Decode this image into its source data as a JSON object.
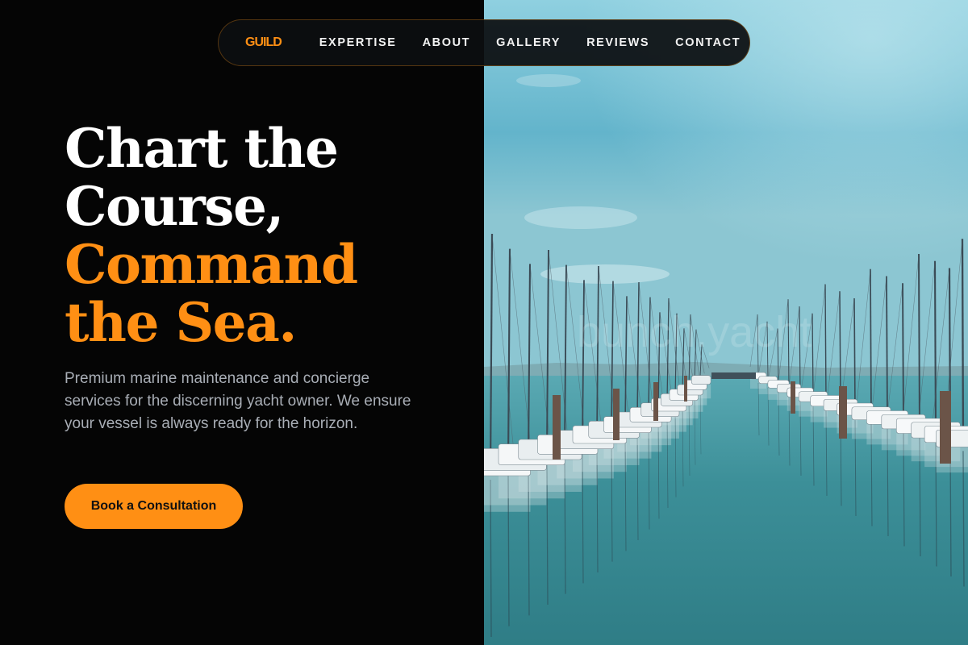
{
  "nav": {
    "logo": "GUILD",
    "links": [
      "EXPERTISE",
      "ABOUT",
      "GALLERY",
      "REVIEWS",
      "CONTACT"
    ]
  },
  "hero": {
    "title_line1": "Chart the",
    "title_line2": "Course,",
    "title_line3": "Command",
    "title_line4": "the Sea.",
    "description": "Premium marine maintenance and concierge services for the discerning yacht owner. We ensure your vessel is always ready for the horizon.",
    "cta_label": "Book a Consultation"
  },
  "image": {
    "watermark": "bunch.yacht"
  },
  "colors": {
    "accent": "#ff8f14",
    "background": "#050505",
    "text_muted": "#a9aeb6",
    "water": "#3f8f93",
    "sky": "#6cb8cc"
  }
}
